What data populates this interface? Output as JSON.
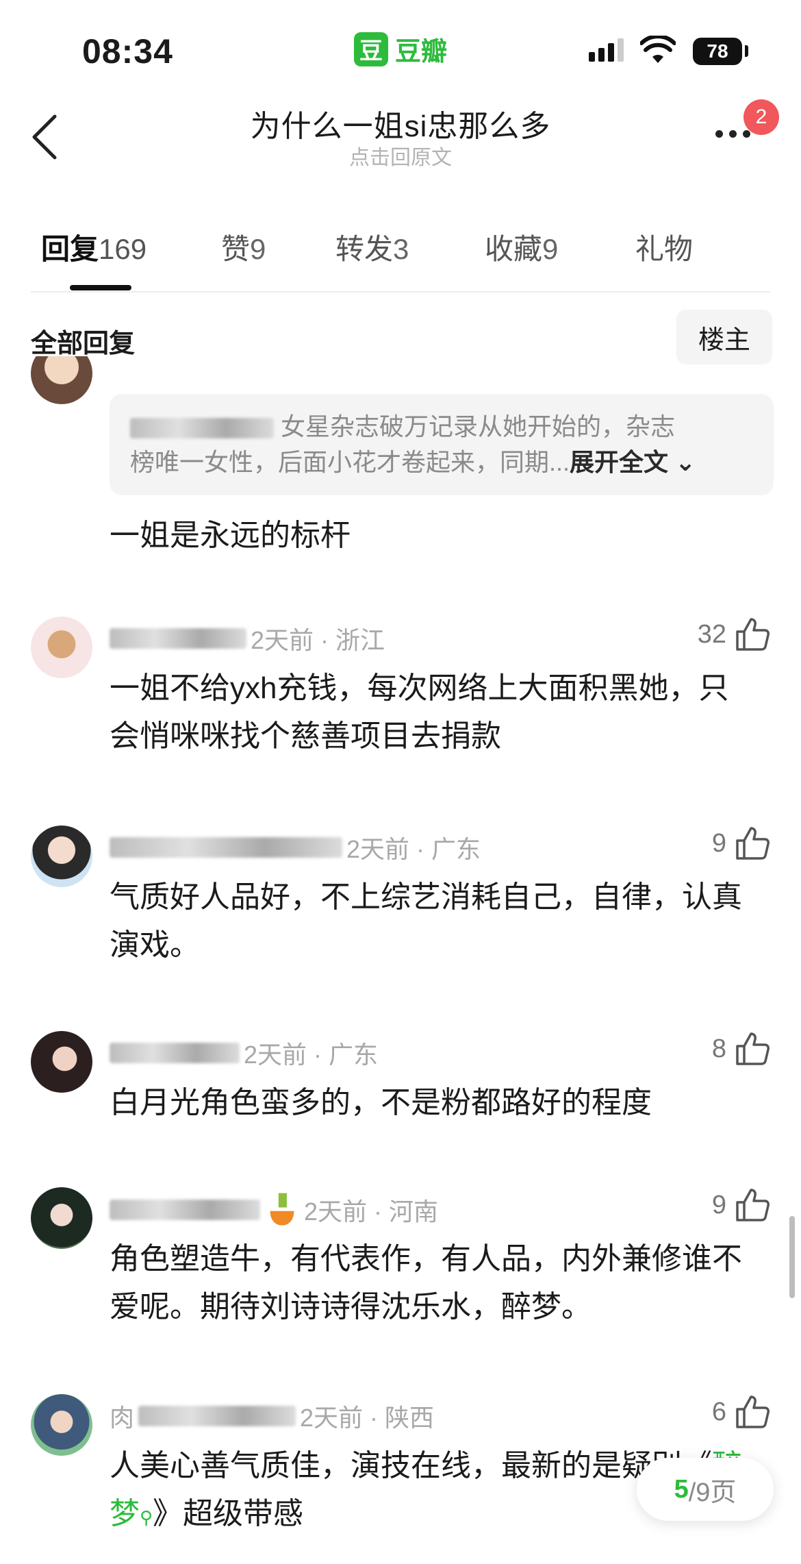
{
  "status_bar": {
    "time": "08:34",
    "app_name": "豆瓣",
    "app_logo_char": "豆",
    "battery": "78"
  },
  "nav": {
    "title": "为什么一姐si忠那么多",
    "subtitle": "点击回原文",
    "notification_count": "2"
  },
  "tabs": [
    {
      "label": "回复",
      "count": "169",
      "active": true
    },
    {
      "label": "赞",
      "count": "9"
    },
    {
      "label": "转发",
      "count": "3"
    },
    {
      "label": "收藏",
      "count": "9"
    },
    {
      "label": "礼物",
      "count": ""
    }
  ],
  "section": {
    "label": "全部回复",
    "owner_button": "楼主"
  },
  "first_reply": {
    "quote_text_line1": "女星杂志破万记录从她开始的，杂志",
    "quote_text_line2": "榜唯一女性，后面小花才卷起来，同期...",
    "expand_label": "展开全文",
    "text": "一姐是永远的标杆"
  },
  "comments": [
    {
      "meta": "2天前 · 浙江",
      "likes": "32",
      "text": "一姐不给yxh充钱，每次网络上大面积黑她，只会悄咪咪找个慈善项目去捐款"
    },
    {
      "meta": "2天前 · 广东",
      "likes": "9",
      "text": "气质好人品好，不上综艺消耗自己，自律，认真演戏。"
    },
    {
      "meta": "2天前 · 广东",
      "likes": "8",
      "text": "白月光角色蛮多的，不是粉都路好的程度"
    },
    {
      "meta": "2天前 · 河南",
      "likes": "9",
      "text": "角色塑造牛，有代表作，有人品，内外兼修谁不爱呢。期待刘诗诗得沈乐水，醉梦。"
    },
    {
      "meta": "2天前 · 陕西",
      "likes": "6",
      "text_before": "人美心善气质佳，演技在线，最新的是疑别《",
      "highlight": "醉梦",
      "text_after": "》超级带感",
      "user_prefix": "肉"
    }
  ],
  "pager": {
    "current": "5",
    "total": "/9页"
  },
  "colors": {
    "accent": "#2dbb3c",
    "badge": "#f0585b"
  }
}
